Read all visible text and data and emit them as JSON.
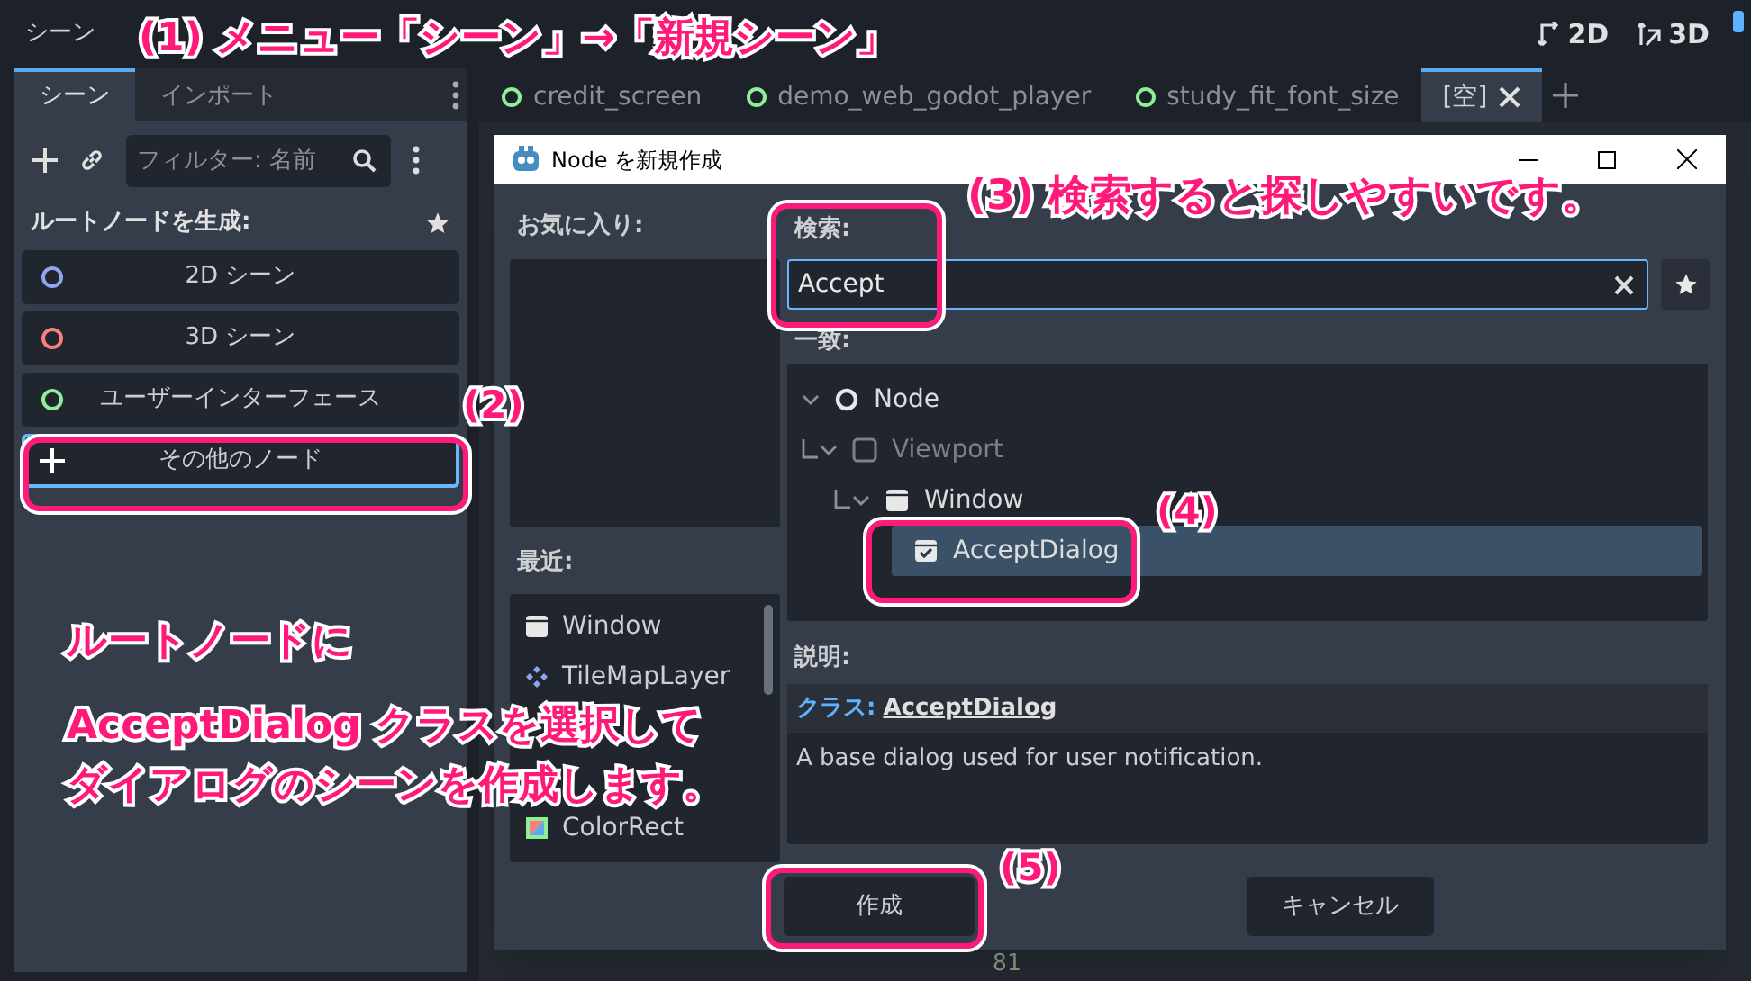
{
  "menu_bar": {
    "items": [
      "シーン"
    ],
    "view_buttons": [
      {
        "label": "2D",
        "kind": "twod"
      },
      {
        "label": "3D",
        "kind": "threed"
      }
    ]
  },
  "scene_dock": {
    "tabs": [
      {
        "label": "シーン",
        "selected": true
      },
      {
        "label": "インポート",
        "selected": false
      }
    ],
    "filter": {
      "placeholder": "フィルター: 名前"
    },
    "create_root_label": "ルートノードを生成:",
    "root_buttons": [
      {
        "label": "2D シーン",
        "kind": "circle",
        "color": "#8da5f3",
        "focused": false
      },
      {
        "label": "3D シーン",
        "kind": "circle",
        "color": "#fc7f7f",
        "focused": false
      },
      {
        "label": "ユーザーインターフェース",
        "kind": "circle",
        "color": "#8eef97",
        "focused": false
      },
      {
        "label": "その他のノード",
        "kind": "plus",
        "focused": true
      }
    ]
  },
  "editor_tabs": [
    {
      "label": "credit_screen",
      "selected": false,
      "closable": false
    },
    {
      "label": "demo_web_godot_player",
      "selected": false,
      "closable": false
    },
    {
      "label": "study_fit_font_size",
      "selected": false,
      "closable": false
    },
    {
      "label": "[空]",
      "selected": true,
      "closable": true
    }
  ],
  "editor": {
    "line_number": "81"
  },
  "dialog": {
    "title": "Node を新規作成",
    "favorites_label": "お気に入り:",
    "recent_label": "最近:",
    "recent": [
      {
        "label": "Window",
        "kind": "window"
      },
      {
        "label": "TileMapLayer",
        "kind": "tilemap"
      },
      {
        "label": "ColorRect",
        "kind": "colorrect"
      }
    ],
    "search_label": "検索:",
    "search": {
      "value": "Accept"
    },
    "matches_label": "一致:",
    "tree": [
      {
        "label": "Node",
        "kind": "node",
        "selected": false,
        "disabled": false,
        "expanded": true,
        "children": [
          {
            "label": "Viewport",
            "kind": "viewport",
            "selected": false,
            "disabled": true,
            "expanded": true,
            "children": [
              {
                "label": "Window",
                "kind": "window",
                "selected": false,
                "disabled": false,
                "expanded": true,
                "children": [
                  {
                    "label": "AcceptDialog",
                    "kind": "dialog",
                    "selected": true,
                    "disabled": false,
                    "expanded": false
                  }
                ]
              }
            ]
          }
        ]
      }
    ],
    "description_label": "説明:",
    "description": {
      "class_label": "クラス:",
      "class_name": "AcceptDialog",
      "text": "A base dialog used for user notification."
    },
    "buttons": [
      {
        "label": "作成",
        "kind": "create"
      },
      {
        "label": "キャンセル",
        "kind": "cancel"
      }
    ]
  },
  "annotations": [
    {
      "kind": "title",
      "text": "(1) メニュー「シーン」→「新規シーン」"
    },
    {
      "kind": "step2",
      "text": "(2)"
    },
    {
      "kind": "step3",
      "text": "(3) 検索すると探しやすいです。"
    },
    {
      "kind": "step4",
      "text": "(4)"
    },
    {
      "kind": "step5",
      "text": "(5)"
    },
    {
      "kind": "note",
      "lines": [
        "ルートノードに",
        "AcceptDialog クラスを選択して",
        "ダイアログのシーンを作成します。"
      ]
    }
  ]
}
